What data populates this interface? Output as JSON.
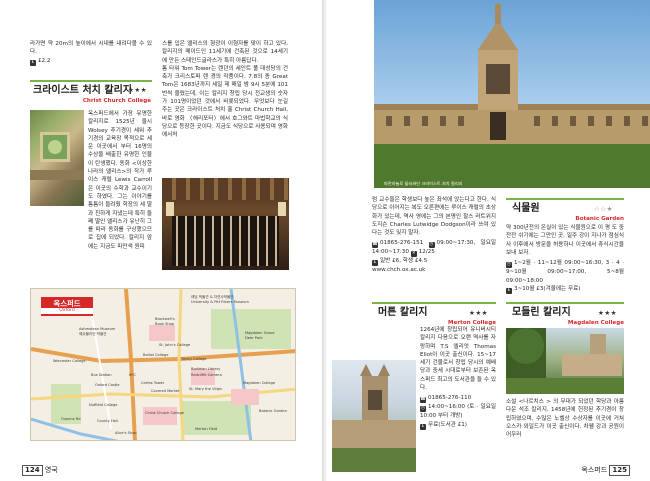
{
  "left_page": {
    "intro_text": "라가면 약 20m의 높이에서 시내를 내려다볼 수 있다.",
    "intro_price": "£2.2",
    "christ_church": {
      "title_ko": "크라이스트 처치 칼리지",
      "title_en": "Christ Church College",
      "stars": "★★★",
      "col1_text": "옥스퍼드에서 가장 유명한 칼리지로 1525년 울시 Wolsey 추기경이 세워 추기경의 교육장 목적으로 세운 이곳에서 부터 16명의 수상을 배출한 유명한 인물이 탄생했다. 동화 <이상한 나라의 앨리스>의 작가 루이스 캐럴 Lewis Carroll은 이곳의 수학과 교수이기도 하였다. 그는 이야기를 틈틈이 들려줬 학장의 세 딸과 친하게 지냈는데 특히 둘째 딸인 앨리스가 유난히 그를 따라 동화를 구상했으므로 집에 되었다. 칼리지 앞에는 지금도 피만색 원피",
      "col2_text": "스를 입은 앨리스의 형광이 이형자를 맞이 하고 있다. 칼리지의 메이드인 11세기에 건축된 것으로 14세기에 만든 스테인드글라스가 특히 아름답다.",
      "col2_text2": "톰 타워 Tom Tower는 렌던의 세인트 폴 대성당의 건축가 크리스토퍼 렌 경의 작품이다. 7.8의 종 Great Tom은 1683년까지 세일 제 매일 밤 9시 5분에 101번씩 울렸는데, 이는 칼리지 창립 당시 전교생의 숫자가 101명이었던 것에서 비롯되었다. 무엇보다 눈길 주는 곳은 크라이스트 처치 홀 Christ Church Hall, 바로 영화 〈해리포터〉에서 호그와트 마법학교의 식당으로 등장한 곳이다. 지금도 식당으로 사용되며 영화에서처"
    },
    "map": {
      "title_ko": "옥스퍼드",
      "title_en": "Oxford",
      "labels": [
        "레딩 박물관 & 자연사박물관",
        "University & Pitt Rivers Museum",
        "Ashmolean Museum",
        "애쉬몰리언 박물관",
        "Blackwell's",
        "Book Shop",
        "Magdalen Grove",
        "Deer Park",
        "St. John's College",
        "Balliol College",
        "Trinity College",
        "Bus Station",
        "KFC",
        "Oxford Castle",
        "Carfax Tower",
        "Covered Market",
        "Christ Church College",
        "Merton Field",
        "Alice's Shop",
        "Botanic Garden",
        "St. Mary the Virgin",
        "Radcliffe Camera",
        "Bodleian Library",
        "Magdalen College",
        "Oxpens Rd",
        "Nuffield College",
        "Worcester College",
        "County Hall"
      ]
    },
    "page_number": "124",
    "page_label": "영국"
  },
  "right_page": {
    "photo_caption": "파란하늘로 둘러싸인 크라이스트 처치 칼리지",
    "christ_church_cont": {
      "text": "럼 교수들은 학생보다 높은 좌석에 앉는다고 한다. 식당으로 이어지는 복도 오른편에는 루이스 캐럴의 초상화가 있는데, 역사 영에는 그의 본명인 찰스 러트위지 도지슨 Charles Lutwidge Dodgson이라 쓰여 있다는 것도 잊지 말자.",
      "phone": "01865-276-151",
      "hours": "09:00~17:30, 일요일 14:00~17:30",
      "closed": "12/25",
      "price": "일반 £6, 학생 £4.5",
      "url": "www.chch.ox.ac.uk"
    },
    "botanic": {
      "title_ko": "식물원",
      "title_en": "Botanic Garden",
      "stars": "☆☆★",
      "text": "약 300년전의 온실이 있는 식물원으로 이 평 도 중 잔잔 쉬기에는 그만인 곳. 일주 강이 지나가 점심식사 이후에서 방문을 허용하니 이곳에서 휴식시간을 보내 보자.",
      "hours1": "1~2월 · 11~12월 09:00~16:30, 3 · 4 · 9~10월 09:00~17:00, 5~8월 09:00~18:00",
      "price": "3~10월 £3(겨울에는 무료)"
    },
    "merton": {
      "title_ko": "머튼 칼리지",
      "title_en": "Merton College",
      "stars": "★★★",
      "text": "1264년에 창립되어 유니버시티 칼리지 다음으로 오랜 역사를 자랑하며 T.S 엘리엇 Thomas Eliot이 이곳 출신이다. 15~17세기 건물로서 창립 당시의 예배당과 중세 시대로부터 보존된 옥스퍼드 최고의 도서관을 들 수 있다.",
      "phone": "01865-276-110",
      "hours": "14:00~16:00 (토 · 일요일 10:00 부터 개방)",
      "price": "무료(도서관 £1)"
    },
    "magdalen": {
      "title_ko": "모들린 칼리지",
      "title_en": "Magdalen College",
      "stars": "★★★",
      "text": "소설 <나르치스 > 의 무대가 되었던 학당과 아름다운 석조 칼리지. 1458년에 헌정된 추기경이 창립하였으며, 수많은 노벨상 수상자를 이곳에 거쳐 오스카 와일드가 이곳 출신이다. 차웰 강과 공원이 어우러"
    },
    "page_number": "125",
    "page_label": "옥스퍼드"
  },
  "colors": {
    "accent_green": "#7cb342",
    "accent_red": "#d62828"
  }
}
